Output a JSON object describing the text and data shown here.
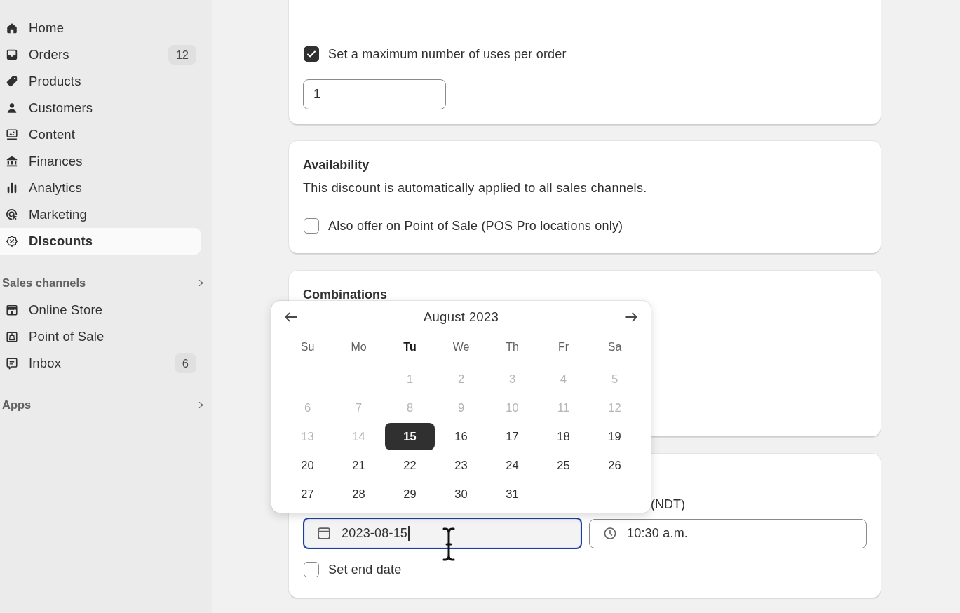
{
  "sidebar": {
    "items": [
      {
        "label": "Home",
        "selected": false
      },
      {
        "label": "Orders",
        "badge": "12",
        "selected": false
      },
      {
        "label": "Products",
        "selected": false
      },
      {
        "label": "Customers",
        "selected": false
      },
      {
        "label": "Content",
        "selected": false
      },
      {
        "label": "Finances",
        "selected": false
      },
      {
        "label": "Analytics",
        "selected": false
      },
      {
        "label": "Marketing",
        "selected": false
      },
      {
        "label": "Discounts",
        "selected": true
      }
    ],
    "sections": [
      {
        "title": "Sales channels",
        "items": [
          {
            "label": "Online Store",
            "selected": false
          },
          {
            "label": "Point of Sale",
            "selected": false
          },
          {
            "label": "Inbox",
            "badge": "6",
            "selected": false
          }
        ]
      },
      {
        "title": "Apps"
      }
    ]
  },
  "usage_card": {
    "max_uses_checkbox": {
      "label": "Set a maximum number of uses per order",
      "checked": true
    },
    "max_uses_input": {
      "value": "1"
    }
  },
  "availability_card": {
    "title": "Availability",
    "description": "This discount is automatically applied to all sales channels.",
    "pos_checkbox": {
      "label": "Also offer on Point of Sale (POS Pro locations only)",
      "checked": false
    }
  },
  "combinations_card": {
    "title": "Combinations"
  },
  "date_picker": {
    "title": "August 2023",
    "weekdays": [
      {
        "label": "Su",
        "highlighted": false
      },
      {
        "label": "Mo",
        "highlighted": false
      },
      {
        "label": "Tu",
        "highlighted": true
      },
      {
        "label": "We",
        "highlighted": false
      },
      {
        "label": "Th",
        "highlighted": false
      },
      {
        "label": "Fr",
        "highlighted": false
      },
      {
        "label": "Sa",
        "highlighted": false
      }
    ],
    "weeks": [
      [
        {
          "label": "1",
          "disabled": true,
          "selected": false
        },
        {
          "label": "2",
          "disabled": true,
          "selected": false
        },
        {
          "label": "3",
          "disabled": true,
          "selected": false
        },
        {
          "label": "4",
          "disabled": true,
          "selected": false
        },
        {
          "label": "5",
          "disabled": true,
          "selected": false
        }
      ],
      [
        {
          "label": "6",
          "disabled": true,
          "selected": false
        },
        {
          "label": "7",
          "disabled": true,
          "selected": false
        },
        {
          "label": "8",
          "disabled": true,
          "selected": false
        },
        {
          "label": "9",
          "disabled": true,
          "selected": false
        },
        {
          "label": "10",
          "disabled": true,
          "selected": false
        },
        {
          "label": "11",
          "disabled": true,
          "selected": false
        },
        {
          "label": "12",
          "disabled": true,
          "selected": false
        }
      ],
      [
        {
          "label": "13",
          "disabled": true,
          "selected": false
        },
        {
          "label": "14",
          "disabled": true,
          "selected": false
        },
        {
          "label": "15",
          "disabled": false,
          "selected": true
        },
        {
          "label": "16",
          "disabled": false,
          "selected": false
        },
        {
          "label": "17",
          "disabled": false,
          "selected": false
        },
        {
          "label": "18",
          "disabled": false,
          "selected": false
        },
        {
          "label": "19",
          "disabled": false,
          "selected": false
        }
      ],
      [
        {
          "label": "20",
          "disabled": false,
          "selected": false
        },
        {
          "label": "21",
          "disabled": false,
          "selected": false
        },
        {
          "label": "22",
          "disabled": false,
          "selected": false
        },
        {
          "label": "23",
          "disabled": false,
          "selected": false
        },
        {
          "label": "24",
          "disabled": false,
          "selected": false
        },
        {
          "label": "25",
          "disabled": false,
          "selected": false
        },
        {
          "label": "26",
          "disabled": false,
          "selected": false
        }
      ],
      [
        {
          "label": "27",
          "disabled": false,
          "selected": false
        },
        {
          "label": "28",
          "disabled": false,
          "selected": false
        },
        {
          "label": "29",
          "disabled": false,
          "selected": false
        },
        {
          "label": "30",
          "disabled": false,
          "selected": false
        },
        {
          "label": "31",
          "disabled": false,
          "selected": false
        }
      ]
    ]
  },
  "dates_card": {
    "time_label": "(NDT)",
    "start_date_field": {
      "value": "2023-08-15",
      "focused": true
    },
    "start_time_field": {
      "value": "10:30 a.m."
    },
    "end_date_checkbox": {
      "label": "Set end date",
      "checked": false
    }
  }
}
